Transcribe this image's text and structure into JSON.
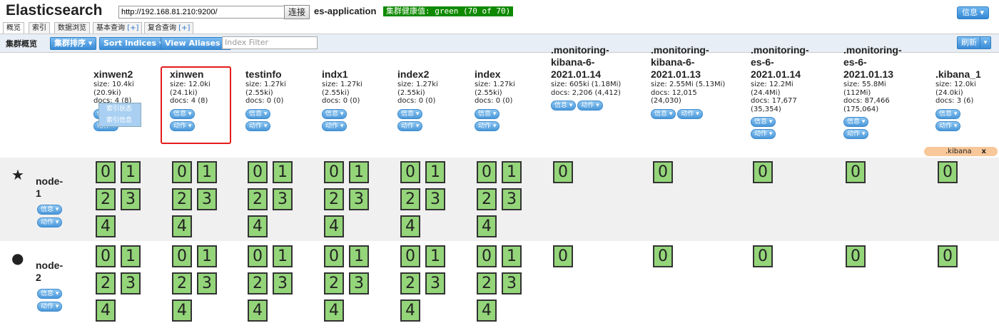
{
  "header": {
    "app_title": "Elasticsearch",
    "url_value": "http://192.168.81.210:9200/",
    "connect_label": "连接",
    "cluster_name": "es-application",
    "health_text": "集群健康值: green (70 of 70)",
    "health_color": "#0f8a00",
    "info_label": "信息"
  },
  "tabs": [
    {
      "label": "概览"
    },
    {
      "label": "索引"
    },
    {
      "label": "数据浏览"
    },
    {
      "label": "基本查询",
      "plus": "[+]"
    },
    {
      "label": "复合查询",
      "plus": "[+]"
    }
  ],
  "toolbar": {
    "label": "集群概览",
    "sort_cluster": "集群排序",
    "sort_indices": "Sort Indices",
    "view_aliases": "View Aliases",
    "filter_placeholder": "Index Filter",
    "refresh": "刷新"
  },
  "pill_labels": {
    "info": "信息",
    "action": "动作"
  },
  "popup": {
    "item1": "索引状态",
    "item2": "索引信息"
  },
  "alias": {
    "name": ".kibana",
    "close": "x"
  },
  "indices": [
    {
      "name": "xinwen2",
      "meta": "size: 10.4ki\n(20.9ki)\ndocs: 4 (8)"
    },
    {
      "name": "xinwen",
      "meta": "size: 12.0ki\n(24.1ki)\ndocs: 4 (8)"
    },
    {
      "name": "testinfo",
      "meta": "size: 1.27ki\n(2.55ki)\ndocs: 0 (0)"
    },
    {
      "name": "indx1",
      "meta": "size: 1.27ki\n(2.55ki)\ndocs: 0 (0)"
    },
    {
      "name": "index2",
      "meta": "size: 1.27ki\n(2.55ki)\ndocs: 0 (0)"
    },
    {
      "name": "index",
      "meta": "size: 1.27ki\n(2.55ki)\ndocs: 0 (0)"
    },
    {
      "name": ".monitoring-\nkibana-6-\n2021.01.14",
      "meta": "size: 605ki (1.18Mi)\ndocs: 2,206 (4,412)"
    },
    {
      "name": ".monitoring-\nkibana-6-\n2021.01.13",
      "meta": "size: 2.55Mi (5.13Mi)\ndocs: 12,015\n(24,030)"
    },
    {
      "name": ".monitoring-\nes-6-\n2021.01.14",
      "meta": "size: 12.2Mi\n(24.4Mi)\ndocs: 17,677\n(35,354)"
    },
    {
      "name": ".monitoring-\nes-6-\n2021.01.13",
      "meta": "size: 55.8Mi\n(112Mi)\ndocs: 87,466\n(175,064)"
    },
    {
      "name": ".kibana_1",
      "meta": "size: 12.0ki\n(24.0ki)\ndocs: 3 (6)"
    }
  ],
  "nodes": [
    {
      "name": "node-\n1",
      "icon": "star"
    },
    {
      "name": "node-\n2",
      "icon": "circle"
    }
  ],
  "shard_labels": [
    "0",
    "1",
    "2",
    "3",
    "4"
  ],
  "colors": {
    "shard": "#94d57a",
    "alias": "#f8c79a",
    "highlight": "#e41c1c"
  }
}
